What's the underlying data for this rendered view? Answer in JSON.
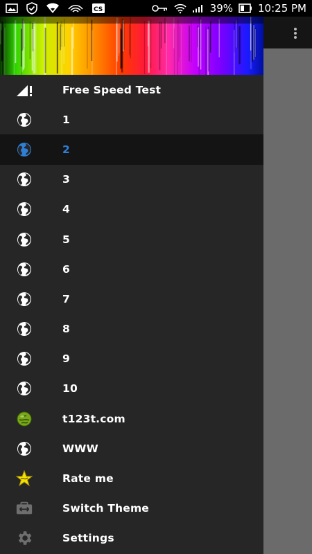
{
  "status_bar": {
    "battery": "39%",
    "time": "10:25 PM",
    "left_icons": [
      "image-icon",
      "shield-check-icon",
      "wifi-heart-icon",
      "wifi-signal-icon",
      "caption-icon"
    ],
    "right_icons": [
      "key-icon",
      "wifi-icon",
      "cell-signal-icon",
      "battery-icon"
    ]
  },
  "colors": {
    "drawer_bg": "#262626",
    "active_bg": "#141414",
    "active_text": "#2f7fd6",
    "scrim": "#6b6b6b"
  },
  "drawer": {
    "items": [
      {
        "label": "Free Speed Test",
        "icon": "signal-alert-icon"
      },
      {
        "label": "1",
        "icon": "globe-icon"
      },
      {
        "label": "2",
        "icon": "globe-icon",
        "active": true
      },
      {
        "label": "3",
        "icon": "globe-icon"
      },
      {
        "label": "4",
        "icon": "globe-icon"
      },
      {
        "label": "5",
        "icon": "globe-icon"
      },
      {
        "label": "6",
        "icon": "globe-icon"
      },
      {
        "label": "7",
        "icon": "globe-icon"
      },
      {
        "label": "8",
        "icon": "globe-icon"
      },
      {
        "label": "9",
        "icon": "globe-icon"
      },
      {
        "label": "10",
        "icon": "globe-icon"
      },
      {
        "label": "t123t.com",
        "icon": "green-globe-icon"
      },
      {
        "label": "WWW",
        "icon": "globe-icon"
      },
      {
        "label": "Rate me",
        "icon": "star-icon"
      },
      {
        "label": "Switch Theme",
        "icon": "switch-theme-icon"
      },
      {
        "label": "Settings",
        "icon": "gear-icon"
      }
    ]
  }
}
